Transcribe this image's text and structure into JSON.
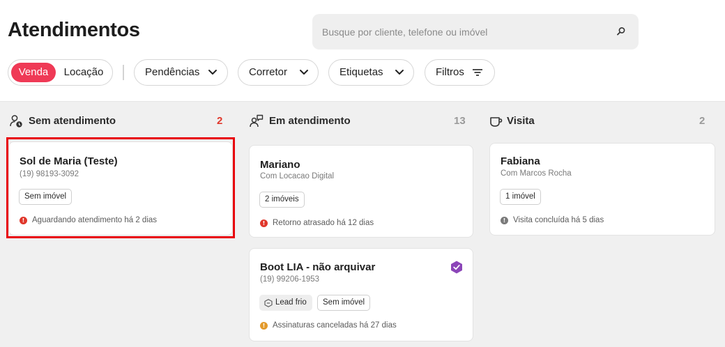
{
  "header": {
    "title": "Atendimentos",
    "search_placeholder": "Busque por cliente, telefone ou imóvel"
  },
  "filters": {
    "segment": {
      "active": "Venda",
      "inactive": "Locação"
    },
    "pendencias": "Pendências",
    "corretor": "Corretor",
    "etiquetas": "Etiquetas",
    "filtros": "Filtros"
  },
  "columns": [
    {
      "title": "Sem atendimento",
      "count": "2",
      "count_color": "#e0372b",
      "cards": [
        {
          "name": "Sol de Maria (Teste)",
          "sub": "(19) 98193-3092",
          "tags": [
            "Sem imóvel"
          ],
          "status": "Aguardando atendimento há 2 dias",
          "status_color": "#e0372b"
        }
      ]
    },
    {
      "title": "Em atendimento",
      "count": "13",
      "count_color": "#9a9a9a",
      "cards": [
        {
          "name": "Mariano",
          "sub": "Com Locacao Digital",
          "tags": [
            "2 imóveis"
          ],
          "status": "Retorno atrasado há 12 dias",
          "status_color": "#e0372b"
        },
        {
          "name": "Boot LIA - não arquivar",
          "sub": "(19) 99206-1953",
          "tags": [
            "Lead frio",
            "Sem imóvel"
          ],
          "status": "Assinaturas canceladas há 27 dias",
          "status_color": "#e39a2b",
          "badge_color": "#8b45b8"
        }
      ]
    },
    {
      "title": "Visita",
      "count": "2",
      "count_color": "#9a9a9a",
      "cards": [
        {
          "name": "Fabiana",
          "sub": "Com Marcos Rocha",
          "tags": [
            "1 imóvel"
          ],
          "status": "Visita concluída há 5 dias",
          "status_color": "#7a7a7a"
        }
      ]
    }
  ],
  "colors": {
    "accent": "#ef3a56",
    "highlight": "#e8000a"
  }
}
